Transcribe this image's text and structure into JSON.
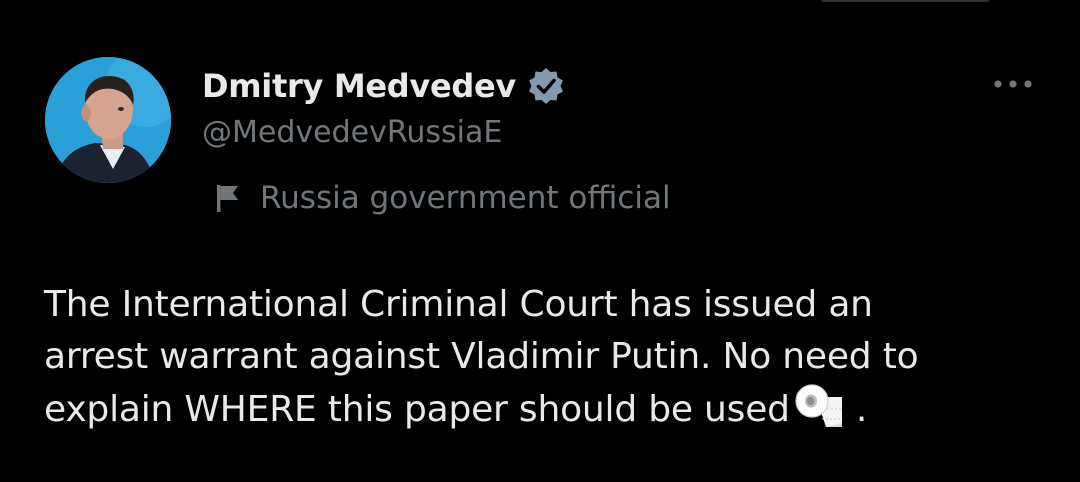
{
  "tweet": {
    "author": {
      "display_name": "Dmitry Medvedev",
      "handle": "@MedvedevRussiaE",
      "verified": true,
      "verified_color": "#829aab"
    },
    "affiliation_label": "Russia government official",
    "text": {
      "line1": "The International Criminal Court has issued an",
      "line2": "arrest warrant against Vladimir Putin. No need to",
      "line3_before_emoji": "explain WHERE this paper should be used",
      "emoji": "toilet-paper-icon",
      "line3_after_emoji": "."
    }
  },
  "colors": {
    "background": "#000000",
    "primary_text": "#e7e9ea",
    "secondary_text": "#71767b",
    "avatar_background": "#2a9fd8"
  },
  "icons": {
    "verified": "verified-badge-icon",
    "more": "more-options-icon",
    "affiliation": "flag-icon"
  }
}
